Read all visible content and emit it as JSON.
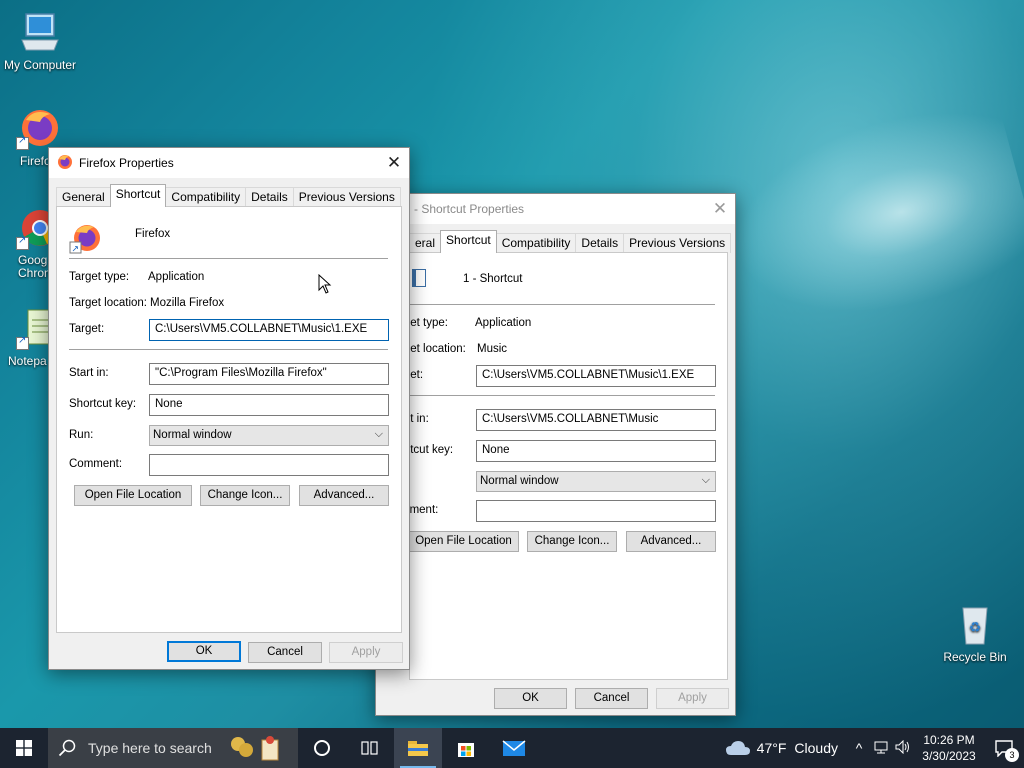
{
  "desktop": {
    "icons": [
      {
        "label": "My Computer"
      },
      {
        "label": "Firefo"
      },
      {
        "label": "Goog\nChron"
      },
      {
        "label": "Notepa"
      },
      {
        "label": "Recycle Bin"
      }
    ]
  },
  "firefox_dialog": {
    "title": "Firefox Properties",
    "tabs": [
      "General",
      "Shortcut",
      "Compatibility",
      "Details",
      "Previous Versions"
    ],
    "active_tab": "Shortcut",
    "name": "Firefox",
    "target_type_label": "Target type:",
    "target_type_value": "Application",
    "target_location_label": "Target location:",
    "target_location_value": "Mozilla Firefox",
    "target_label": "Target:",
    "target_value": "C:\\Users\\VM5.COLLABNET\\Music\\1.EXE",
    "start_in_label": "Start in:",
    "start_in_value": "\"C:\\Program Files\\Mozilla Firefox\"",
    "shortcut_key_label": "Shortcut key:",
    "shortcut_key_value": "None",
    "run_label": "Run:",
    "run_value": "Normal window",
    "comment_label": "Comment:",
    "comment_value": "",
    "open_file_location": "Open File Location",
    "change_icon": "Change Icon...",
    "advanced": "Advanced...",
    "ok": "OK",
    "cancel": "Cancel",
    "apply": "Apply"
  },
  "shortcut_dialog": {
    "title": "- Shortcut Properties",
    "tabs": [
      "eral",
      "Shortcut",
      "Compatibility",
      "Details",
      "Previous Versions"
    ],
    "active_tab": "Shortcut",
    "name": "1 - Shortcut",
    "target_type_label": "rget type:",
    "target_type_value": "Application",
    "target_location_label": "rget location:",
    "target_location_value": "Music",
    "target_label": "rget:",
    "target_value": "C:\\Users\\VM5.COLLABNET\\Music\\1.EXE",
    "start_in_label": "art in:",
    "start_in_value": "C:\\Users\\VM5.COLLABNET\\Music",
    "shortcut_key_label": "ortcut key:",
    "shortcut_key_value": "None",
    "run_label": "n:",
    "run_value": "Normal window",
    "comment_label": "mment:",
    "comment_value": "",
    "open_file_location": "Open File Location",
    "change_icon": "Change Icon...",
    "advanced": "Advanced...",
    "ok": "OK",
    "cancel": "Cancel",
    "apply": "Apply"
  },
  "taskbar": {
    "search_placeholder": "Type here to search",
    "weather_temp": "47°F",
    "weather_desc": "Cloudy",
    "time": "10:26 PM",
    "date": "3/30/2023",
    "notification_count": "3"
  },
  "colors": {
    "accent": "#0078d7",
    "taskbar": "#1c2430",
    "dialog_bg": "#f0f0f0"
  }
}
